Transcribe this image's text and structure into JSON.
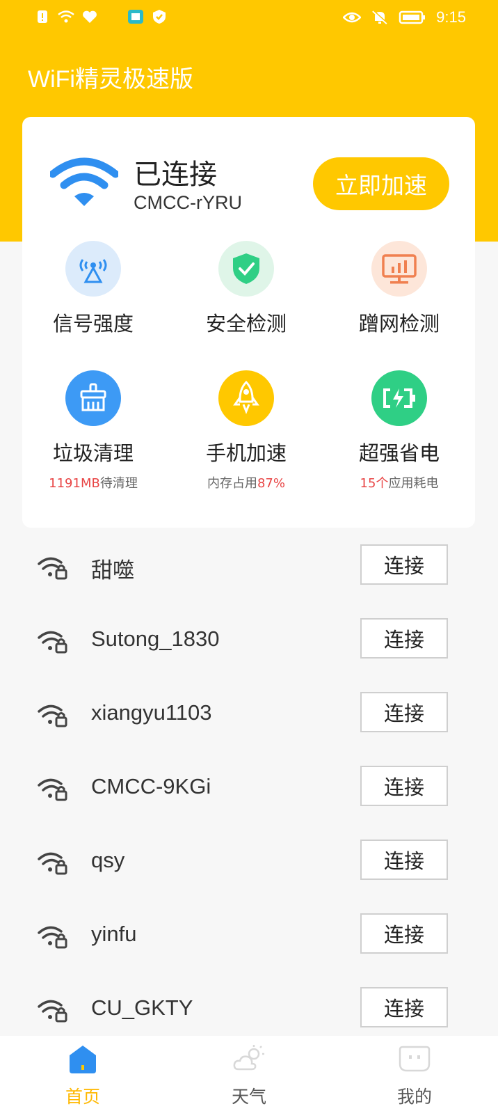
{
  "status_bar": {
    "time": "9:15"
  },
  "app": {
    "title": "WiFi精灵极速版"
  },
  "connection": {
    "status": "已连接",
    "ssid": "CMCC-rYRU",
    "boost_label": "立即加速"
  },
  "tools": [
    {
      "label": "信号强度",
      "icon": "signal-tower-icon"
    },
    {
      "label": "安全检测",
      "icon": "shield-check-icon"
    },
    {
      "label": "蹭网检测",
      "icon": "monitor-chart-icon"
    },
    {
      "label": "垃圾清理",
      "icon": "broom-icon",
      "sub_value": "1191MB",
      "sub_text": "待清理"
    },
    {
      "label": "手机加速",
      "icon": "rocket-icon",
      "sub_text": "内存占用",
      "sub_value": "87%"
    },
    {
      "label": "超强省电",
      "icon": "battery-icon",
      "sub_value": "15个",
      "sub_text": "应用耗电"
    }
  ],
  "wifi_list": [
    {
      "name": "甜噬",
      "action": "连接"
    },
    {
      "name": "Sutong_1830",
      "action": "连接"
    },
    {
      "name": "xiangyu1103",
      "action": "连接"
    },
    {
      "name": "CMCC-9KGi",
      "action": "连接"
    },
    {
      "name": "qsy",
      "action": "连接"
    },
    {
      "name": "yinfu",
      "action": "连接"
    },
    {
      "name": "CU_GKTY",
      "action": "连接"
    }
  ],
  "nav": [
    {
      "label": "首页",
      "icon": "home-icon",
      "active": true
    },
    {
      "label": "天气",
      "icon": "weather-icon",
      "active": false
    },
    {
      "label": "我的",
      "icon": "profile-icon",
      "active": false
    }
  ],
  "colors": {
    "brand": "#ffc800",
    "highlight": "#e84545",
    "signal_bg": "#dcebfb",
    "security_bg": "#dff5e8",
    "monitor_bg": "#fde6d9",
    "clean_bg": "#3d9af5",
    "speed_bg": "#ffc800",
    "power_bg": "#2fcf85"
  }
}
